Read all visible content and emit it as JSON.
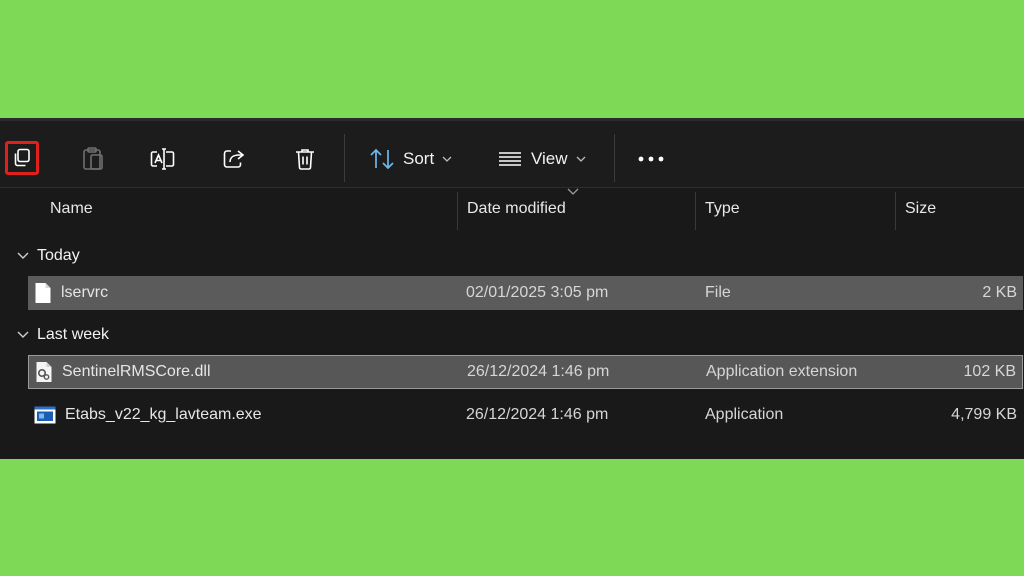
{
  "toolbar": {
    "copy_icon": "copy-icon",
    "paste_icon": "paste-icon",
    "rename_icon": "rename-icon",
    "share_icon": "share-icon",
    "delete_icon": "trash-icon",
    "sort_label": "Sort",
    "view_label": "View",
    "more_icon": "more-icon",
    "highlight_color": "#e0201b"
  },
  "columns": {
    "name": "Name",
    "date": "Date modified",
    "type": "Type",
    "size": "Size"
  },
  "groups": [
    {
      "label": "Today",
      "files": [
        {
          "name": "lservrc",
          "date": "02/01/2025 3:05 pm",
          "type": "File",
          "size": "2 KB",
          "icon": "file-icon",
          "selected": true
        }
      ]
    },
    {
      "label": "Last week",
      "files": [
        {
          "name": "SentinelRMSCore.dll",
          "date": "26/12/2024 1:46 pm",
          "type": "Application extension",
          "size": "102 KB",
          "icon": "dll-file-icon",
          "selected": true
        },
        {
          "name": "Etabs_v22_kg_lavteam.exe",
          "date": "26/12/2024 1:46 pm",
          "type": "Application",
          "size": "4,799 KB",
          "icon": "exe-app-icon",
          "selected": false
        }
      ]
    }
  ],
  "colors": {
    "background": "#7ed957",
    "window": "#191919",
    "selection": "#5b5b5b"
  }
}
